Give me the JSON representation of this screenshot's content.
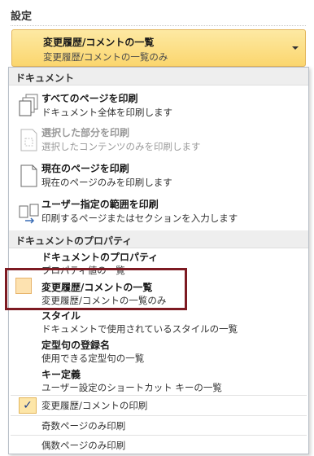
{
  "heading": "設定",
  "combo": {
    "title": "変更履歴/コメントの一覧",
    "subtitle": "変更履歴/コメントの一覧のみ"
  },
  "sections": {
    "document": "ドキュメント",
    "properties": "ドキュメントのプロパティ"
  },
  "print_items": [
    {
      "title": "すべてのページを印刷",
      "desc": "ドキュメント全体を印刷します",
      "icon": "pages-stack-icon"
    },
    {
      "title": "選択した部分を印刷",
      "desc": "選択したコンテンツのみを印刷します",
      "icon": "selection-page-icon"
    },
    {
      "title": "現在のページを印刷",
      "desc": "現在のページのみを印刷します",
      "icon": "single-page-icon"
    },
    {
      "title": "ユーザー指定の範囲を印刷",
      "desc": "印刷するページまたはセクションを入力します",
      "icon": "page-range-icon"
    }
  ],
  "property_items": [
    {
      "title": "ドキュメントのプロパティ",
      "desc": "プロパティ値の一覧"
    },
    {
      "title": "変更履歴/コメントの一覧",
      "desc": "変更履歴/コメントの一覧のみ"
    },
    {
      "title": "スタイル",
      "desc": "ドキュメントで使用されているスタイルの一覧"
    },
    {
      "title": "定型句の登録名",
      "desc": "使用できる定型句の一覧"
    },
    {
      "title": "キー定義",
      "desc": "ユーザー設定のショートカット キーの一覧"
    }
  ],
  "options": [
    {
      "label": "変更履歴/コメントの印刷",
      "checked": true,
      "checkmark": "✓"
    },
    {
      "label": "奇数ページのみ印刷",
      "checked": false
    },
    {
      "label": "偶数ページのみ印刷",
      "checked": false
    }
  ],
  "colors": {
    "highlight_border": "#7d1a22",
    "combo_fill": "#fbd66e",
    "section_bg": "#eeeeee"
  }
}
